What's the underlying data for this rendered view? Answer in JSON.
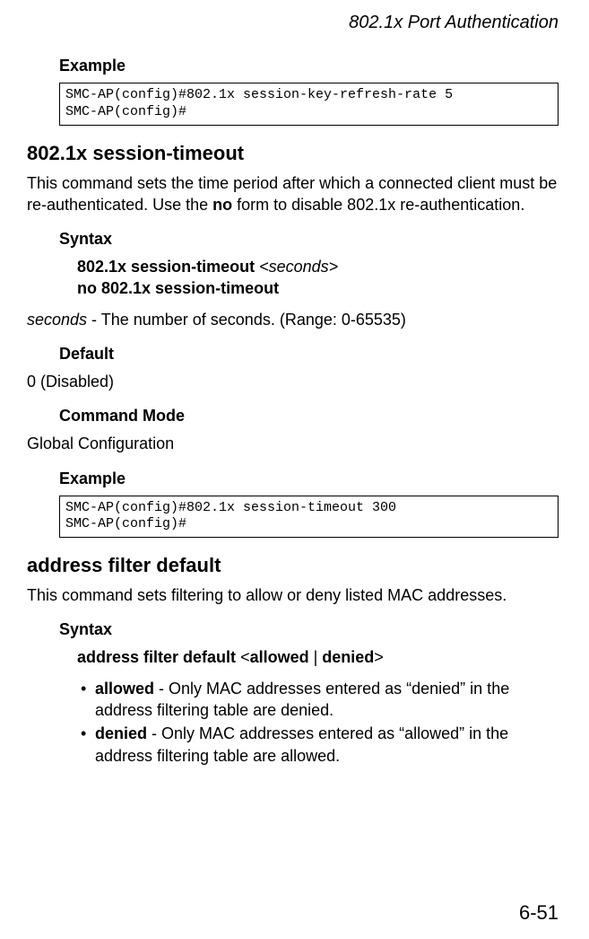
{
  "header": {
    "title": "802.1x Port Authentication"
  },
  "ex1": {
    "label": "Example",
    "code": "SMC-AP(config)#802.1x session-key-refresh-rate 5\nSMC-AP(config)#"
  },
  "sec1": {
    "title": "802.1x session-timeout",
    "desc_a": "This command sets the time period after which a connected client must be re-authenticated. Use the ",
    "desc_b": "no",
    "desc_c": " form to disable 802.1x re-authentication.",
    "syntax_label": "Syntax",
    "syntax_cmd1_a": "802.1x session-timeout ",
    "syntax_cmd1_b": "<seconds>",
    "syntax_cmd2": "no 802.1x session-timeout",
    "param_a": "seconds",
    "param_b": " - The number of seconds. (Range: 0-65535)",
    "default_label": "Default",
    "default_val": "0 (Disabled)",
    "mode_label": "Command Mode",
    "mode_val": "Global Configuration",
    "ex_label": "Example",
    "ex_code": "SMC-AP(config)#802.1x session-timeout 300\nSMC-AP(config)#"
  },
  "sec2": {
    "title": "address filter default",
    "desc": "This command sets filtering to allow or deny listed MAC addresses.",
    "syntax_label": "Syntax",
    "syntax_a": "address filter default ",
    "syntax_b": "<",
    "syntax_c": "allowed",
    "syntax_d": " | ",
    "syntax_e": "denied",
    "syntax_f": ">",
    "b1_a": "allowed",
    "b1_b": " - Only MAC addresses entered as “denied” in the address filtering table are denied.",
    "b2_a": "denied",
    "b2_b": " - Only MAC addresses entered as “allowed” in the address filtering table are allowed."
  },
  "footer": {
    "page": "6-51"
  }
}
